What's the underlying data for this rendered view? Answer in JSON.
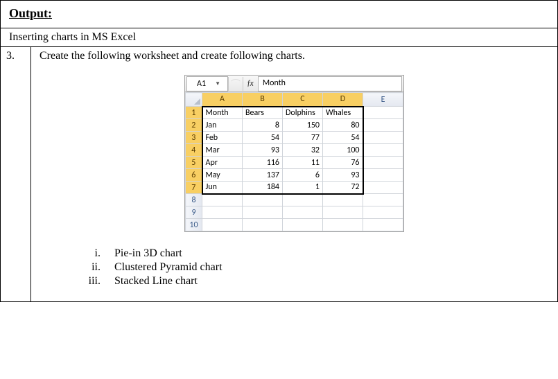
{
  "output_label": "Output:",
  "section_title": "Inserting charts in MS Excel",
  "task_number": "3.",
  "task_instruction": "Create the following worksheet and create following charts.",
  "excel": {
    "name_box": "A1",
    "fx_label": "fx",
    "fx_value": "Month",
    "columns": [
      "A",
      "B",
      "C",
      "D",
      "E"
    ],
    "row_headers": [
      "1",
      "2",
      "3",
      "4",
      "5",
      "6",
      "7",
      "8",
      "9",
      "10"
    ],
    "headers": [
      "Month",
      "Bears",
      "Dolphins",
      "Whales"
    ],
    "rows": [
      {
        "m": "Jan",
        "b": "8",
        "d": "150",
        "w": "80"
      },
      {
        "m": "Feb",
        "b": "54",
        "d": "77",
        "w": "54"
      },
      {
        "m": "Mar",
        "b": "93",
        "d": "32",
        "w": "100"
      },
      {
        "m": "Apr",
        "b": "116",
        "d": "11",
        "w": "76"
      },
      {
        "m": "May",
        "b": "137",
        "d": "6",
        "w": "93"
      },
      {
        "m": "Jun",
        "b": "184",
        "d": "1",
        "w": "72"
      }
    ]
  },
  "chart_list": {
    "i_num": "i.",
    "i_label": "Pie-in 3D chart",
    "ii_num": "ii.",
    "ii_label": "Clustered Pyramid chart",
    "iii_num": "iii.",
    "iii_label": "Stacked Line chart"
  },
  "chart_data": {
    "type": "table",
    "title": "",
    "categories": [
      "Jan",
      "Feb",
      "Mar",
      "Apr",
      "May",
      "Jun"
    ],
    "series": [
      {
        "name": "Bears",
        "values": [
          8,
          54,
          93,
          116,
          137,
          184
        ]
      },
      {
        "name": "Dolphins",
        "values": [
          150,
          77,
          32,
          11,
          6,
          1
        ]
      },
      {
        "name": "Whales",
        "values": [
          80,
          54,
          100,
          76,
          93,
          72
        ]
      }
    ],
    "xlabel": "Month",
    "ylabel": ""
  }
}
